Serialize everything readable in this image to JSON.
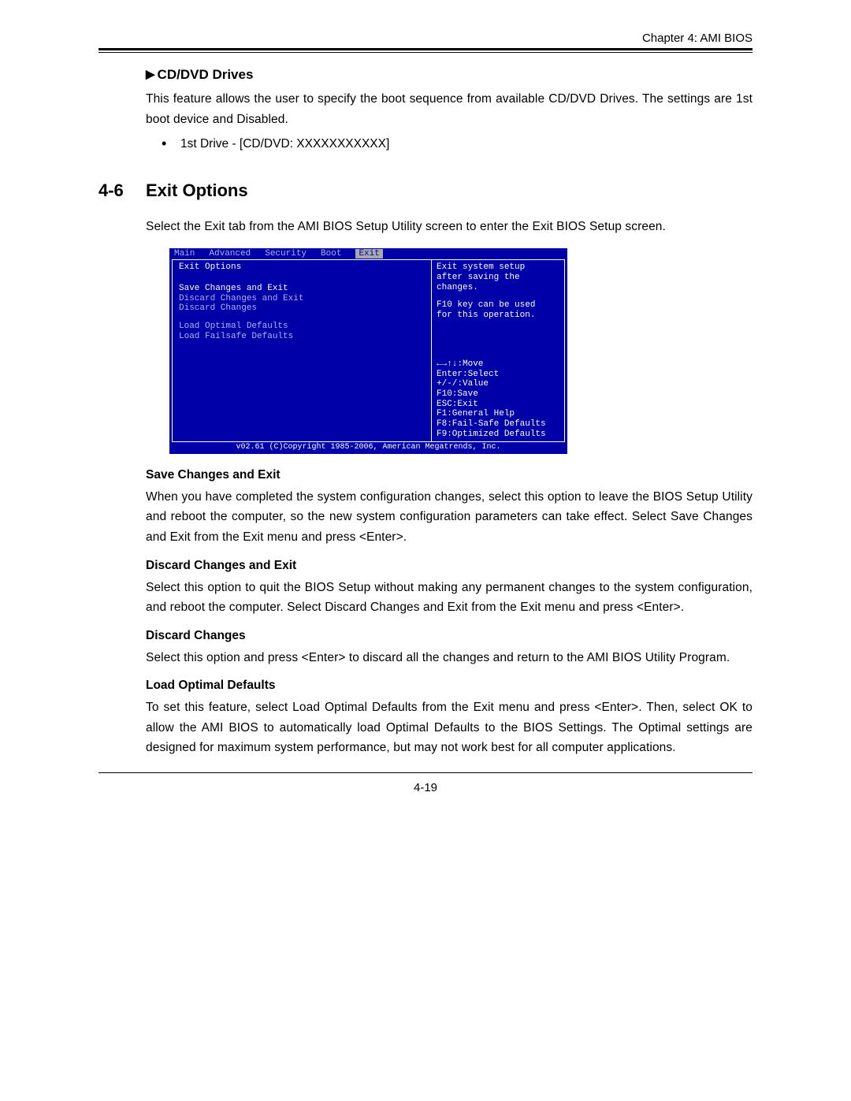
{
  "chapter": "Chapter 4: AMI BIOS",
  "cddvd": {
    "heading": "CD/DVD Drives",
    "para": "This feature allows the user to specify the boot sequence from available CD/DVD Drives. The settings are 1st boot device and Disabled.",
    "bullet": "1st Drive - [CD/DVD: XXXXXXXXXXX]"
  },
  "section": {
    "num": "4-6",
    "title": "Exit Options",
    "intro": "Select the Exit tab from the AMI BIOS Setup Utility screen to enter the Exit BIOS Setup screen."
  },
  "bios": {
    "tabs": [
      "Main",
      "Advanced",
      "Security",
      "Boot",
      "Exit"
    ],
    "active_tab": "Exit",
    "panel_title": "Exit Options",
    "items": [
      "Save Changes and Exit",
      "Discard Changes and Exit",
      "Discard Changes",
      "",
      "Load Optimal Defaults",
      "Load Failsafe Defaults"
    ],
    "help1": "Exit system setup",
    "help2": "after saving the",
    "help3": "changes.",
    "help4": "F10 key can be used",
    "help5": "for this operation.",
    "keys": [
      "←→↑↓:Move",
      "Enter:Select",
      "+/-/:Value",
      "F10:Save",
      "ESC:Exit",
      "F1:General Help",
      "F8:Fail-Safe Defaults",
      "F9:Optimized Defaults"
    ],
    "copyright": "v02.61 (C)Copyright 1985-2006, American Megatrends, Inc."
  },
  "options": [
    {
      "head": "Save Changes and Exit",
      "body": "When you have completed the system configuration changes, select this option to leave the BIOS Setup Utility and reboot the computer, so the new system configuration parameters can take effect. Select Save Changes and Exit from the Exit menu and press <Enter>."
    },
    {
      "head": "Discard Changes and Exit",
      "body": "Select this option to quit the BIOS Setup without making any permanent changes to the system configuration, and reboot the computer. Select Discard Changes and Exit from the Exit menu and press <Enter>."
    },
    {
      "head": "Discard Changes",
      "body": "Select this option and press <Enter> to discard all the changes and return to the AMI BIOS Utility Program."
    },
    {
      "head": "Load Optimal Defaults",
      "body": "To set this feature, select Load Optimal Defaults from the Exit menu and press <Enter>. Then, select OK to allow the AMI BIOS to automatically load Optimal Defaults to the BIOS Settings. The Optimal settings are designed for maximum system performance, but may not work best for all computer applications."
    }
  ],
  "page_num": "4-19"
}
